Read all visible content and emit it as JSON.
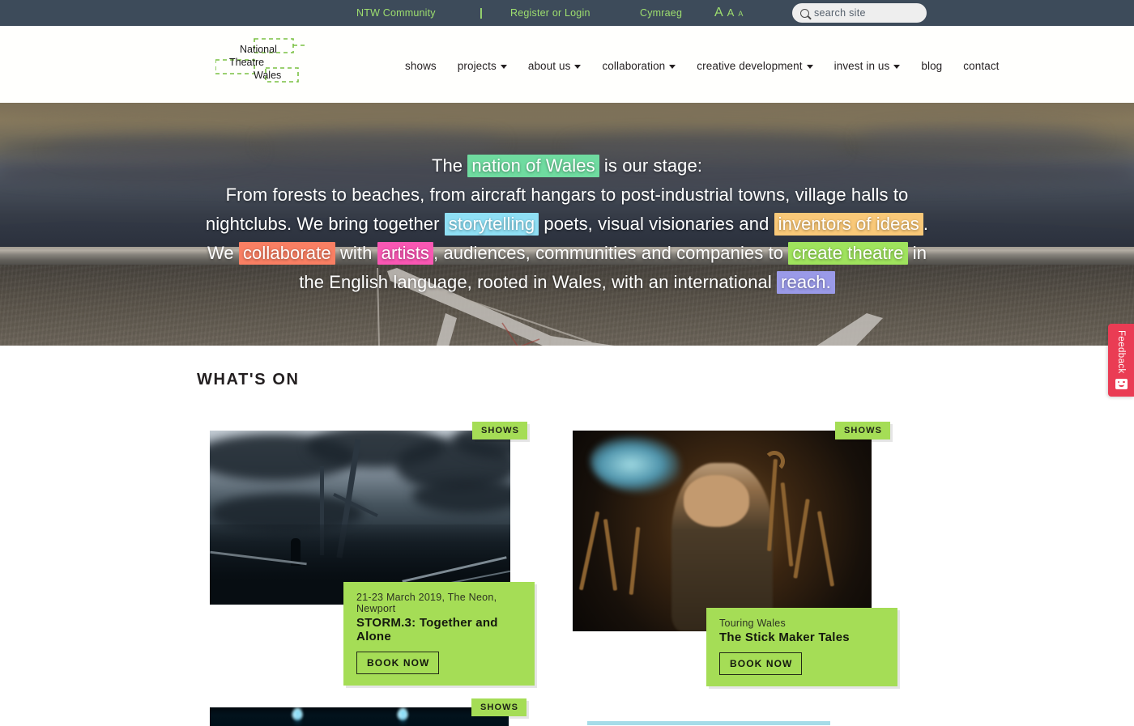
{
  "topbar": {
    "community_link": "NTW Community",
    "separator": "|",
    "register_link": "Register or Login",
    "language_link": "Cymraeg",
    "text_size": {
      "large": "A",
      "medium": "A",
      "small": "A"
    },
    "search": {
      "placeholder": "search site",
      "icon": "search-icon"
    },
    "bg_color": "#3d4b5a",
    "link_color": "#9ede6f"
  },
  "logo": {
    "line1": "National",
    "line2": "Theatre",
    "line3": "Wales",
    "accent_color": "#7ac143"
  },
  "nav": {
    "items": [
      {
        "label": "shows",
        "has_dropdown": false
      },
      {
        "label": "projects",
        "has_dropdown": true
      },
      {
        "label": "about us",
        "has_dropdown": true
      },
      {
        "label": "collaboration",
        "has_dropdown": true
      },
      {
        "label": "creative development",
        "has_dropdown": true
      },
      {
        "label": "invest in us",
        "has_dropdown": true
      },
      {
        "label": "blog",
        "has_dropdown": false
      },
      {
        "label": "contact",
        "has_dropdown": false
      }
    ]
  },
  "hero": {
    "line1_pre": "The ",
    "line1_hl": "nation of Wales",
    "line1_post": " is our stage:",
    "line2": "From forests to beaches, from aircraft hangars to post-industrial towns, village halls to",
    "line3_pre": "nightclubs. We bring together ",
    "line3_hl1": "storytelling",
    "line3_mid": " poets, visual visionaries and ",
    "line3_hl2": "inventors of ideas",
    "line3_post": ".",
    "line4_pre": "We ",
    "line4_hl1": "collaborate",
    "line4_mid1": " with ",
    "line4_hl2": "artists",
    "line4_mid2": ", audiences, communities and companies to ",
    "line4_hl3": "create theatre",
    "line4_post": " in",
    "line5_pre": "the English language, rooted in Wales, with an international ",
    "line5_hl": "reach.",
    "highlight_colors": {
      "nation_of_wales": "#6fdba0",
      "storytelling": "#8fdff4",
      "inventors_of_ideas": "#f9c878",
      "collaborate": "#f97f63",
      "artists": "#f957b3",
      "create_theatre": "#9fe35d",
      "reach": "#9a9ae8"
    }
  },
  "whats_on": {
    "heading": "WHAT'S ON",
    "cards": [
      {
        "badge": "SHOWS",
        "meta": "21-23 March 2019, The Neon, Newport",
        "title": "STORM.3: Together and Alone",
        "cta": "BOOK NOW",
        "image_alt": "bridge-at-dusk-photo"
      },
      {
        "badge": "SHOWS",
        "meta": "Touring Wales",
        "title": "The Stick Maker Tales",
        "cta": "BOOK NOW",
        "image_alt": "stick-maker-performer-photo"
      },
      {
        "badge": "SHOWS",
        "image_alt": "stage-lights-photo"
      }
    ],
    "card_bg_color": "#a5dd56"
  },
  "feedback": {
    "label": "Feedback",
    "icon": "smiley-face-icon",
    "color": "#ea3c54"
  }
}
